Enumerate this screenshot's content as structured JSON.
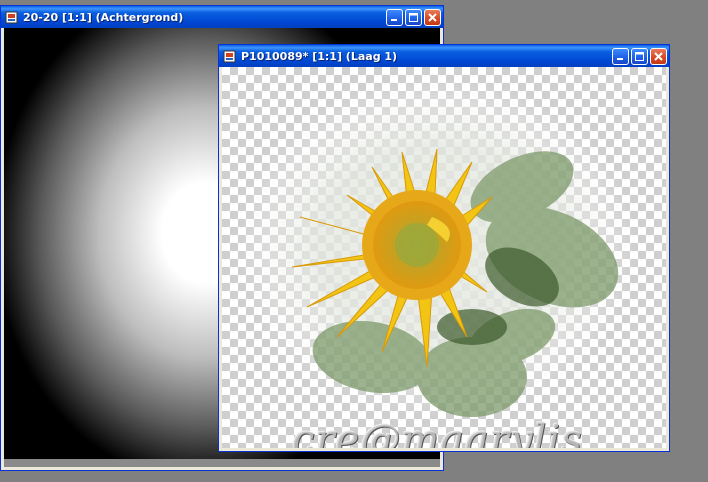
{
  "windows": [
    {
      "title": "20-20 [1:1] (Achtergrond)",
      "content": "radial gradient background"
    },
    {
      "title": "P1010089* [1:1] (Laag 1)",
      "content": "sunflower image on transparent layer",
      "watermark": "cre@maarylis"
    }
  ],
  "colors": {
    "titlebar": "#0a5fe0",
    "close_button": "#d8481e",
    "desktop": "#808080"
  },
  "icons": [
    "app-icon",
    "minimize-icon",
    "maximize-icon",
    "close-icon",
    "sunflower-image"
  ]
}
